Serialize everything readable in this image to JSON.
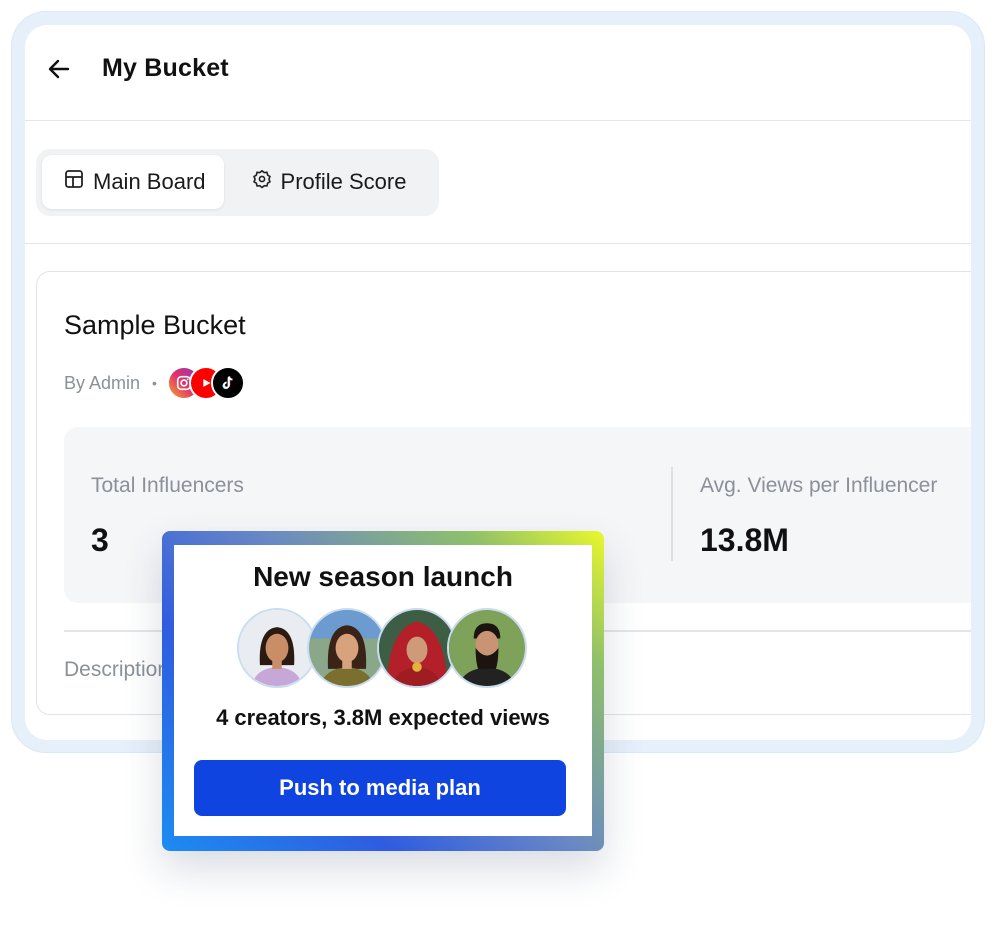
{
  "header": {
    "title": "My Bucket"
  },
  "tabs": [
    {
      "label": "Main Board",
      "icon": "table-icon",
      "active": true
    },
    {
      "label": "Profile Score",
      "icon": "badge-check-icon",
      "active": false
    }
  ],
  "bucket": {
    "name": "Sample Bucket",
    "byline": "By Admin",
    "separator": "•",
    "platforms": [
      "instagram-icon",
      "youtube-icon",
      "tiktok-icon"
    ],
    "stats": [
      {
        "label": "Total Influencers",
        "value": "3"
      },
      {
        "label": "Avg. Views per Influencer",
        "value": "13.8M"
      }
    ],
    "description_label": "Description"
  },
  "popup": {
    "title": "New season launch",
    "summary": "4 creators, 3.8M expected views",
    "button_label": "Push to media plan",
    "avatars": [
      "creator-avatar-1",
      "creator-avatar-2",
      "creator-avatar-3",
      "creator-avatar-4"
    ]
  },
  "colors": {
    "accent": "#0f44e0",
    "frame": "#e6f0fa",
    "muted_text": "#8b9099"
  }
}
